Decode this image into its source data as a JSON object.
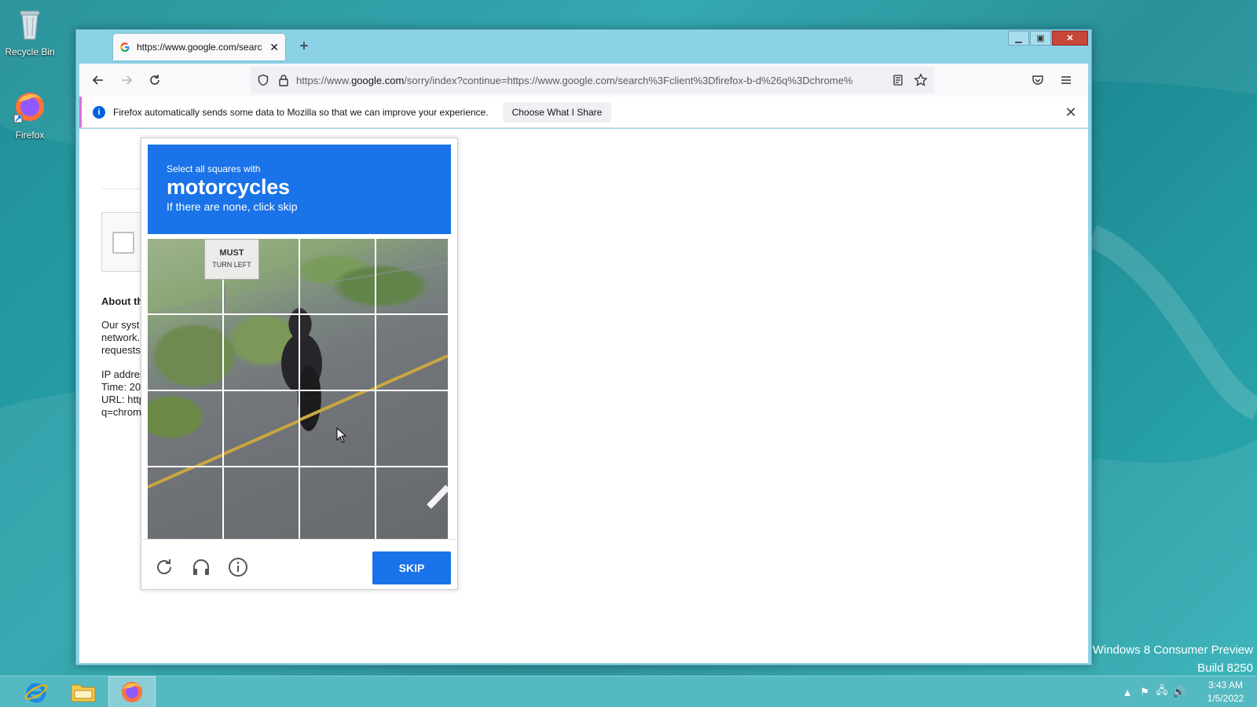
{
  "desktop": {
    "icons": [
      {
        "label": "Recycle Bin"
      },
      {
        "label": "Firefox"
      }
    ],
    "watermark": {
      "line1": "Windows 8 Consumer Preview",
      "line2": "Build 8250"
    }
  },
  "browser": {
    "tab": {
      "title": "https://www.google.com/searc"
    },
    "url": {
      "prefix": "https://www.",
      "domain": "google.com",
      "rest": "/sorry/index?continue=https://www.google.com/search%3Fclient%3Dfirefox-b-d%26q%3Dchrome%"
    },
    "notification": {
      "message": "Firefox automatically sends some data to Mozilla so that we can improve your experience.",
      "button": "Choose What I Share"
    }
  },
  "page": {
    "about_heading": "About th",
    "para1": [
      "Our syst",
      "network.",
      "requests"
    ],
    "para2": [
      "IP addres",
      "Time: 20",
      "URL: http",
      "q=chrom"
    ]
  },
  "captcha": {
    "instruction_small": "Select all squares with",
    "target": "motorcycles",
    "instruction_sub": "If there are none, click skip",
    "sign_text": [
      "MUST",
      "TURN LEFT"
    ],
    "skip_label": "SKIP",
    "grid_rows": 4,
    "grid_cols": 4
  },
  "taskbar": {
    "clock_time": "3:43 AM",
    "clock_date": "1/5/2022"
  },
  "colors": {
    "captcha_blue": "#1a73e8",
    "desktop_teal": "#28a3ab",
    "taskbar": "#55b9c2"
  }
}
